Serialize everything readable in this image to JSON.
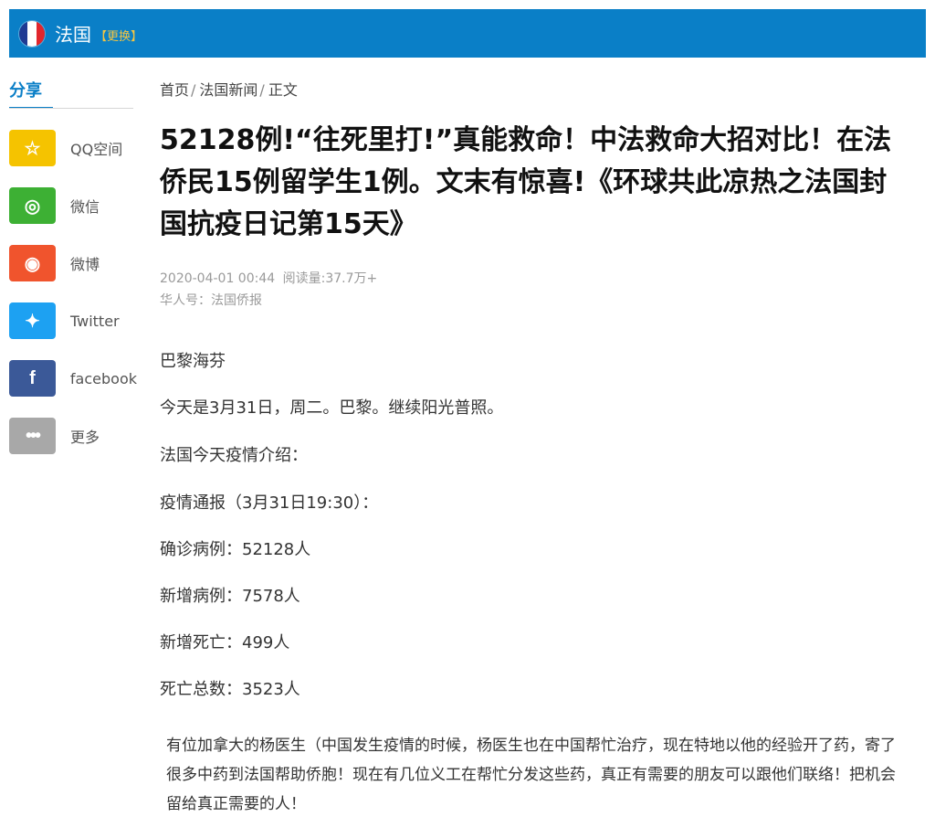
{
  "header": {
    "country": "法国",
    "change_label": "【更换】",
    "flag_colors": [
      "#1f3a93",
      "#ffffff",
      "#e1262d"
    ]
  },
  "sidebar": {
    "title": "分享",
    "items": [
      {
        "label": "QQ空间",
        "icon": "qzone-icon",
        "glyph": "☆",
        "color": "#f5c300"
      },
      {
        "label": "微信",
        "icon": "wechat-icon",
        "glyph": "◎",
        "color": "#3db034"
      },
      {
        "label": "微博",
        "icon": "weibo-icon",
        "glyph": "◉",
        "color": "#f0542d"
      },
      {
        "label": "Twitter",
        "icon": "twitter-icon",
        "glyph": "✦",
        "color": "#1da1f2"
      },
      {
        "label": "facebook",
        "icon": "facebook-icon",
        "glyph": "f",
        "color": "#3b5998"
      },
      {
        "label": "更多",
        "icon": "more-icon",
        "glyph": "•••",
        "color": "#a8a8a8"
      }
    ]
  },
  "breadcrumb": {
    "home": "首页",
    "section": "法国新闻",
    "current": "正文",
    "sep": "/"
  },
  "article": {
    "title": "52128例!“往死里打!”真能救命！中法救命大招对比！在法侨民15例留学生1例。文末有惊喜!《环球共此凉热之法国封国抗疫日记第15天》",
    "date": "2020-04-01 00:44",
    "views": "阅读量:37.7万+",
    "author": "华人号：法国侨报",
    "paragraphs": [
      "巴黎海芬",
      "今天是3月31日，周二。巴黎。继续阳光普照。",
      "法国今天疫情介绍：",
      "疫情通报（3月31日19:30）：",
      "确诊病例：52128人",
      "新增病例：7578人",
      "新增死亡：499人",
      "死亡总数：3523人"
    ],
    "notice": "有位加拿大的杨医生（中国发生疫情的时候，杨医生也在中国帮忙治疗，现在特地以他的经验开了药，寄了很多中药到法国帮助侨胞！现在有几位义工在帮忙分发这些药，真正有需要的朋友可以跟他们联络！把机会留给真正需要的人！"
  }
}
